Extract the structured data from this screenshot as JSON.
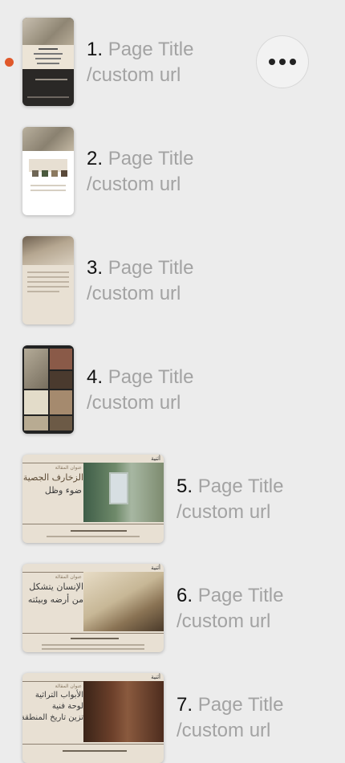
{
  "pages": [
    {
      "number": "1.",
      "title": "Page Title",
      "url": "/custom url",
      "active": true
    },
    {
      "number": "2.",
      "title": "Page Title",
      "url": "/custom url"
    },
    {
      "number": "3.",
      "title": "Page Title",
      "url": "/custom url"
    },
    {
      "number": "4.",
      "title": "Page Title",
      "url": "/custom url"
    },
    {
      "number": "5.",
      "title": "Page Title",
      "url": "/custom url",
      "thumb": {
        "section": "عنوان المقالة",
        "heading_1": "الزخارف الجصية",
        "heading_2": "ضوء وظل",
        "logo": "أثنية"
      }
    },
    {
      "number": "6.",
      "title": "Page Title",
      "url": "/custom url",
      "thumb": {
        "section": "عنوان المقالة",
        "heading_1": "الإنسان يتشكل",
        "heading_2": "من أرضه وبيئته",
        "logo": "أثنية"
      }
    },
    {
      "number": "7.",
      "title": "Page Title",
      "url": "/custom url",
      "thumb": {
        "section": "عنوان المقالة",
        "heading_1": "الأبواب التراثية",
        "heading_2": "لوحة فنية",
        "heading_3": "تزين تاريخ المنطقة",
        "logo": "أثنية"
      }
    }
  ],
  "colors": {
    "active_dot": "#e0582a",
    "label_gray": "#a3a3a3",
    "background": "#ececec"
  }
}
